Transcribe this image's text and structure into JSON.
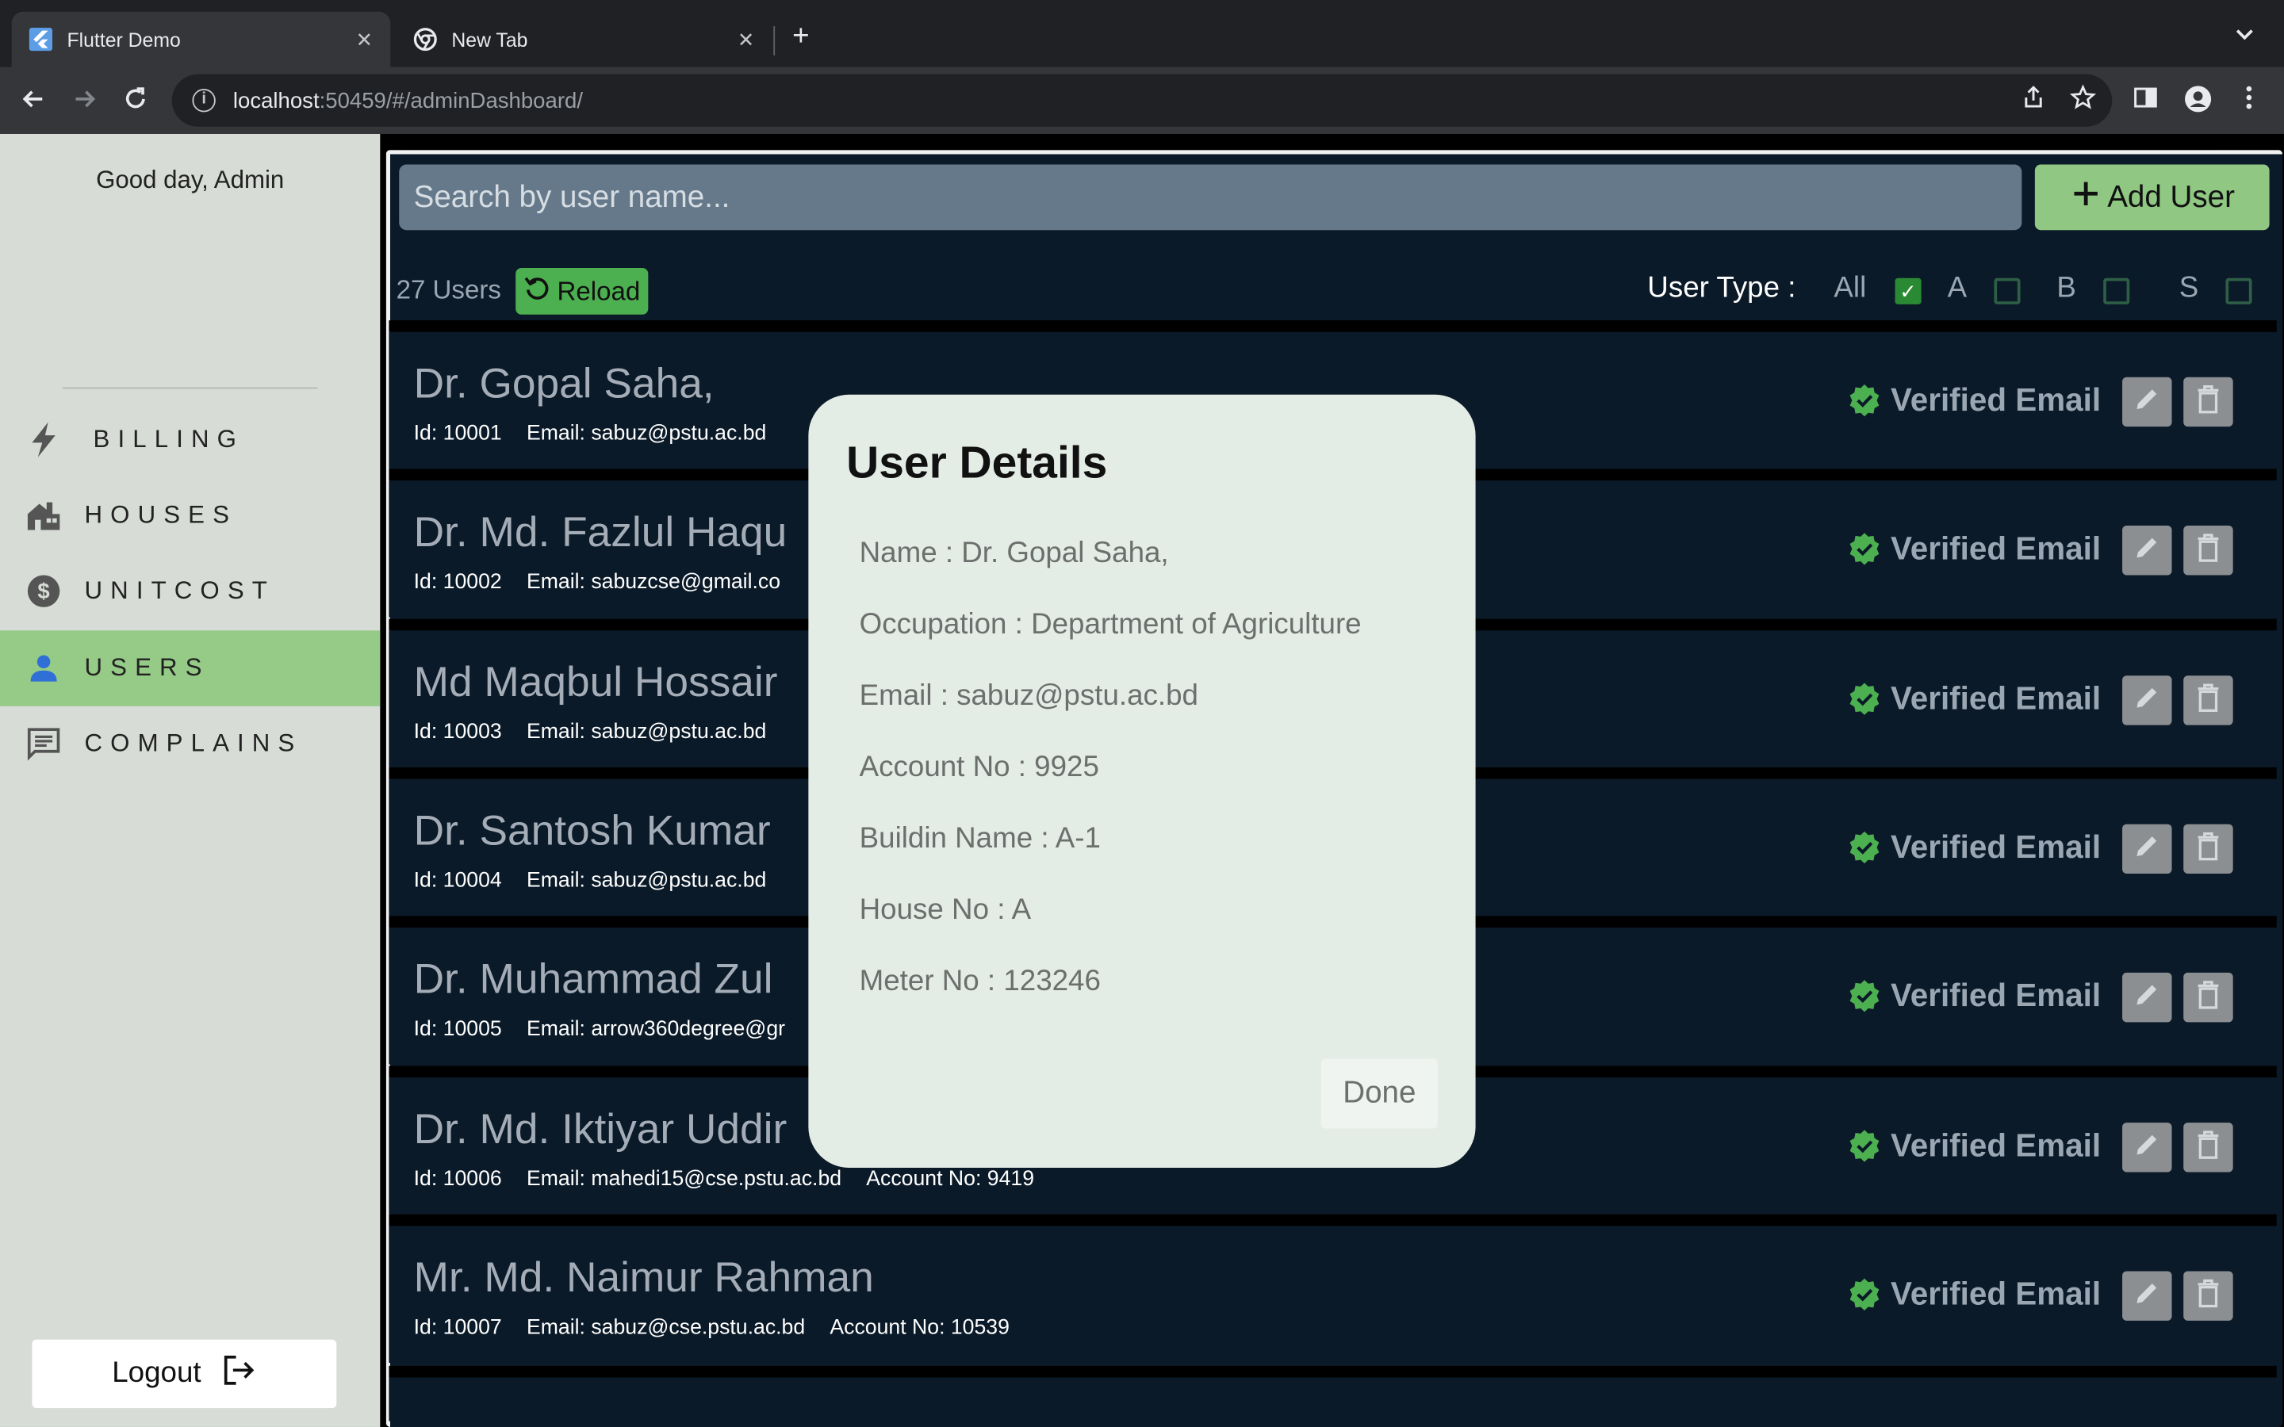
{
  "browser": {
    "tabs": [
      {
        "title": "Flutter Demo"
      },
      {
        "title": "New Tab"
      }
    ],
    "url_host": "localhost",
    "url_rest": ":50459/#/adminDashboard/"
  },
  "sidebar": {
    "greeting": "Good day, Admin",
    "items": [
      {
        "label": "BILLING",
        "icon": "bolt-icon"
      },
      {
        "label": "HOUSES",
        "icon": "houses-icon"
      },
      {
        "label": "UNITCOST",
        "icon": "dollar-icon"
      },
      {
        "label": "USERS",
        "icon": "person-icon",
        "active": true
      },
      {
        "label": "COMPLAINS",
        "icon": "chat-icon"
      }
    ],
    "logout_label": "Logout"
  },
  "toolbar": {
    "search_placeholder": "Search by user name...",
    "add_user_label": "Add User",
    "user_count": "27 Users",
    "reload_label": "Reload",
    "user_type_label": "User Type :",
    "filters": [
      {
        "label": "All",
        "checked": true
      },
      {
        "label": "A",
        "checked": false
      },
      {
        "label": "B",
        "checked": false
      },
      {
        "label": "S",
        "checked": false
      }
    ]
  },
  "users": [
    {
      "name": "Dr. Gopal Saha,",
      "id": "Id: 10001",
      "email": "Email: sabuz@pstu.ac.bd",
      "account": "",
      "status": "Verified Email"
    },
    {
      "name": "Dr. Md. Fazlul Haqu",
      "id": "Id: 10002",
      "email": "Email: sabuzcse@gmail.co",
      "account": "",
      "status": "Verified Email"
    },
    {
      "name": "Md Maqbul Hossair",
      "id": "Id: 10003",
      "email": "Email: sabuz@pstu.ac.bd",
      "account": "",
      "status": "Verified Email"
    },
    {
      "name": "Dr. Santosh Kumar",
      "id": "Id: 10004",
      "email": "Email: sabuz@pstu.ac.bd",
      "account": "",
      "status": "Verified Email"
    },
    {
      "name": " Dr. Muhammad Zul",
      "id": "Id: 10005",
      "email": "Email: arrow360degree@gr",
      "account": "",
      "status": "Verified Email"
    },
    {
      "name": "Dr. Md. Iktiyar Uddir",
      "id": "Id: 10006",
      "email": "Email: mahedi15@cse.pstu.ac.bd",
      "account": "Account No: 9419",
      "status": "Verified Email"
    },
    {
      "name": "Mr. Md. Naimur Rahman",
      "id": "Id: 10007",
      "email": "Email: sabuz@cse.pstu.ac.bd",
      "account": "Account No: 10539",
      "status": "Verified Email"
    }
  ],
  "dialog": {
    "title": "User Details",
    "lines": [
      "Name : Dr. Gopal Saha,",
      "Occupation : Department of Agriculture",
      "Email : sabuz@pstu.ac.bd",
      "Account No : 9925",
      "Buildin Name : A-1",
      "House No : A",
      "Meter No : 123246"
    ],
    "done_label": "Done"
  },
  "colors": {
    "accent_green": "#8fc783",
    "panel_bg": "#0b1a28",
    "sidebar_bg": "#d7dcd6",
    "verified_green": "#4caf50"
  }
}
